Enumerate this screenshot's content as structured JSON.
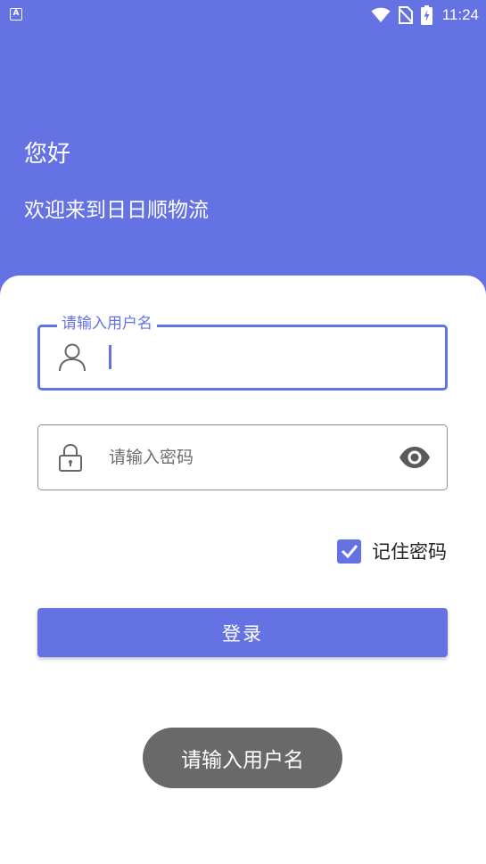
{
  "status_bar": {
    "app_indicator": "A",
    "time": "11:24"
  },
  "header": {
    "greeting": "您好",
    "welcome": "欢迎来到日日顺物流"
  },
  "username_field": {
    "label": "请输入用户名",
    "value": ""
  },
  "password_field": {
    "placeholder": "请输入密码",
    "value": ""
  },
  "remember_password": {
    "label": "记住密码",
    "checked": true
  },
  "login_button": {
    "label": "登录"
  },
  "toast": {
    "message": "请输入用户名"
  },
  "colors": {
    "accent": "#6472e3",
    "toast_bg": "#696969"
  },
  "icons": {
    "username": "user-icon",
    "password": "lock-icon",
    "visibility": "eye-icon",
    "wifi": "wifi-icon",
    "no_sim": "no-sim-icon",
    "battery": "battery-charging-icon"
  }
}
